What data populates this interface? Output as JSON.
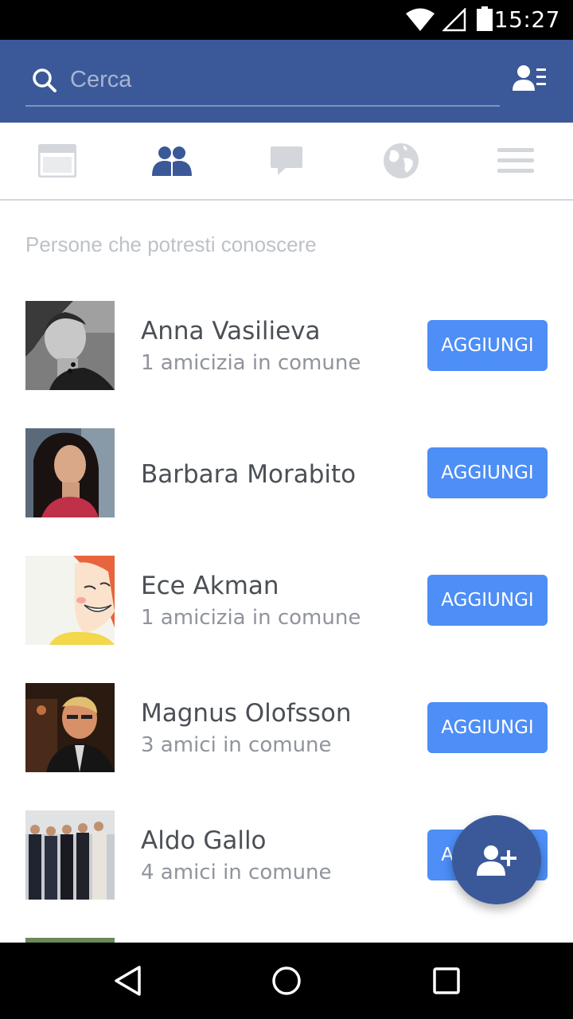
{
  "status_bar": {
    "time": "15:27",
    "icons": [
      "wifi-icon",
      "signal-icon",
      "battery-icon"
    ]
  },
  "header": {
    "search_placeholder": "Cerca",
    "icons": [
      "search-icon",
      "contacts-list-icon"
    ],
    "color": "#3b5998"
  },
  "tabs": [
    {
      "name": "news-feed",
      "icon": "news-feed-icon",
      "active": false
    },
    {
      "name": "friend-requests",
      "icon": "friends-icon",
      "active": true
    },
    {
      "name": "messages",
      "icon": "chat-bubble-icon",
      "active": false
    },
    {
      "name": "notifications",
      "icon": "globe-icon",
      "active": false
    },
    {
      "name": "menu",
      "icon": "hamburger-menu-icon",
      "active": false
    }
  ],
  "section": {
    "title": "Persone che potresti conoscere"
  },
  "people": [
    {
      "name": "Anna Vasilieva",
      "mutual": "1 amicizia in comune",
      "button": "AGGIUNGI"
    },
    {
      "name": "Barbara Morabito",
      "mutual": "",
      "button": "AGGIUNGI"
    },
    {
      "name": "Ece Akman",
      "mutual": "1 amicizia in comune",
      "button": "AGGIUNGI"
    },
    {
      "name": "Magnus Olofsson",
      "mutual": "3 amici in comune",
      "button": "AGGIUNGI"
    },
    {
      "name": "Aldo Gallo",
      "mutual": "4 amici in comune",
      "button": "AGGIUNGI"
    }
  ],
  "fab": {
    "icon": "add-friend-icon"
  },
  "nav_bar": {
    "icons": [
      "back-icon",
      "home-icon",
      "recents-icon"
    ]
  },
  "colors": {
    "brand": "#3b5998",
    "button": "#4d8ef7",
    "tab_active": "#3b5998",
    "tab_inactive": "#d3d6db"
  }
}
